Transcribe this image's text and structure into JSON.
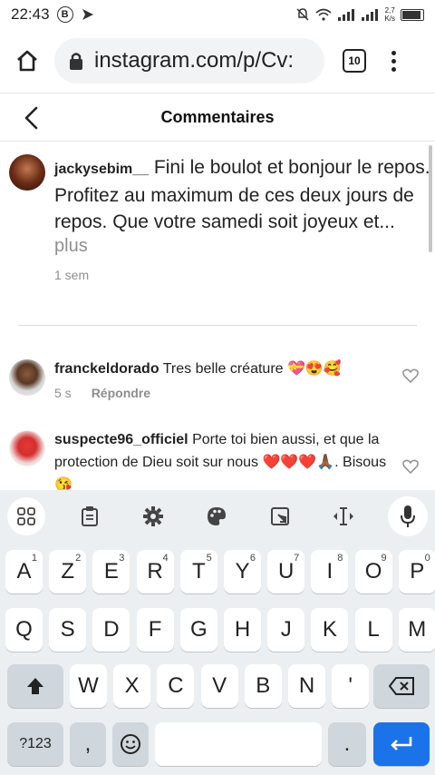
{
  "status_bar": {
    "time": "22:43",
    "badge": "B",
    "net_speed_value": "2,7",
    "net_speed_unit": "K/s"
  },
  "browser": {
    "url": "instagram.com/p/Cv:",
    "tab_count": "10"
  },
  "header": {
    "title": "Commentaires"
  },
  "caption": {
    "username": "jackysebim__",
    "text": " Fini le boulot et bonjour le repos. Profitez au maximum de ces deux jours de repos. Que votre samedi soit joyeux et...",
    "more": "plus",
    "time": "1 sem"
  },
  "comments": [
    {
      "username": "franckeldorado",
      "text": " Tres belle créature 💝😍🥰",
      "time": "5 s",
      "reply": "Répondre"
    },
    {
      "username": "suspecte96_officiel",
      "text": " Porte toi bien aussi, et que la protection de Dieu soit sur nous ❤️❤️❤️🙏🏾. Bisous 😘"
    }
  ],
  "keyboard": {
    "toolbar_icons": [
      "apps-grid-icon",
      "clipboard-icon",
      "settings-gear-icon",
      "palette-icon",
      "resize-icon",
      "text-cursor-icon",
      "microphone-icon"
    ],
    "row1": [
      {
        "label": "A",
        "hint": "1"
      },
      {
        "label": "Z",
        "hint": "2"
      },
      {
        "label": "E",
        "hint": "3"
      },
      {
        "label": "R",
        "hint": "4"
      },
      {
        "label": "T",
        "hint": "5"
      },
      {
        "label": "Y",
        "hint": "6"
      },
      {
        "label": "U",
        "hint": "7"
      },
      {
        "label": "I",
        "hint": "8"
      },
      {
        "label": "O",
        "hint": "9"
      },
      {
        "label": "P",
        "hint": "0"
      }
    ],
    "row2": [
      "Q",
      "S",
      "D",
      "F",
      "G",
      "H",
      "J",
      "K",
      "L",
      "M"
    ],
    "row3": [
      "W",
      "X",
      "C",
      "V",
      "B",
      "N",
      "'"
    ],
    "sym_label": "?123",
    "comma": ",",
    "period": "."
  }
}
